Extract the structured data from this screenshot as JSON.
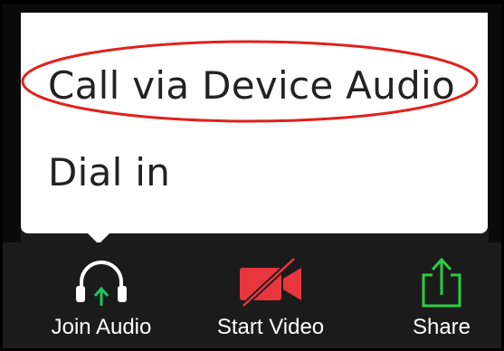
{
  "menu": {
    "items": [
      {
        "label": "Call via Device Audio",
        "highlighted": true
      },
      {
        "label": "Dial in",
        "highlighted": false
      }
    ]
  },
  "toolbar": {
    "items": [
      {
        "label": "Join Audio",
        "icon": "headphones-icon",
        "icon_color": "#ffffff",
        "accent": "#22c55e"
      },
      {
        "label": "Start Video",
        "icon": "video-off-icon",
        "icon_color": "#e8363d"
      },
      {
        "label": "Share",
        "icon": "share-icon",
        "icon_color": "#2ecc40"
      }
    ]
  },
  "colors": {
    "highlight_ring": "#e0211d",
    "toolbar_bg": "#1b1b1b",
    "popup_bg": "#ffffff"
  }
}
